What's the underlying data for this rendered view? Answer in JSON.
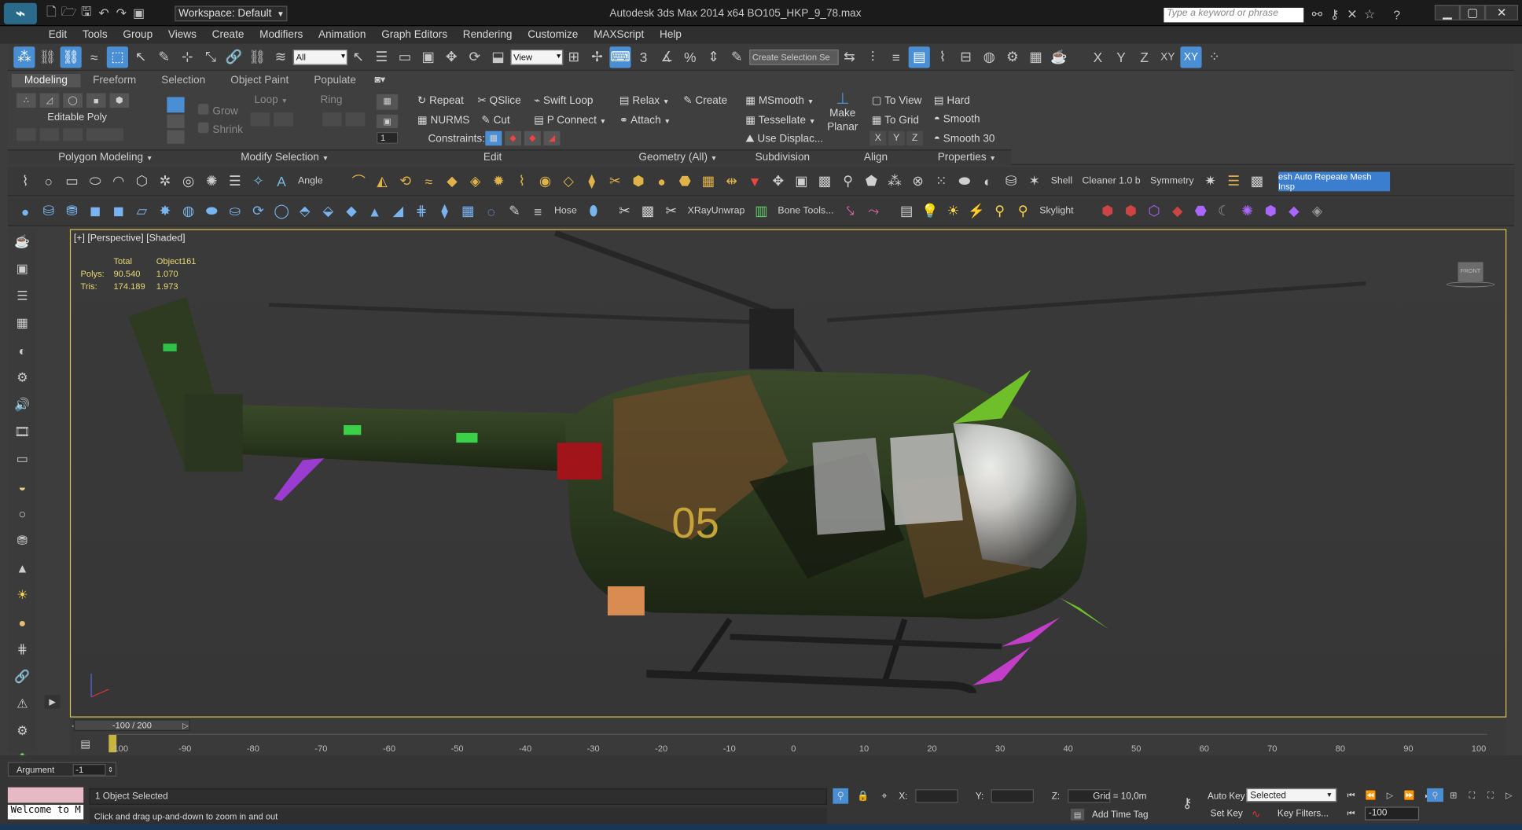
{
  "window": {
    "title": "Autodesk 3ds Max 2014 x64     BO105_HKP_9_78.max",
    "workspace": "Workspace: Default",
    "search_placeholder": "Type a keyword or phrase",
    "logo": "3ds Max"
  },
  "menu": [
    "Edit",
    "Tools",
    "Group",
    "Views",
    "Create",
    "Modifiers",
    "Animation",
    "Graph Editors",
    "Rendering",
    "Customize",
    "MAXScript",
    "Help"
  ],
  "main_toolbar": {
    "selection_filter": "All",
    "ref_coord": "View",
    "named_selection_placeholder": "Create Selection Se",
    "axis_buttons": [
      "X",
      "Y",
      "Z",
      "XY",
      "XY"
    ]
  },
  "ribbon": {
    "tabs": [
      "Modeling",
      "Freeform",
      "Selection",
      "Object Paint",
      "Populate"
    ],
    "active_tab": "Modeling",
    "editable_poly": "Editable Poly",
    "grow": "Grow",
    "shrink": "Shrink",
    "loop": "Loop",
    "ring": "Ring",
    "spinner_value": "1",
    "edit_buttons": [
      "Repeat",
      "QSlice",
      "Swift Loop",
      "NURMS",
      "Cut",
      "P Connect"
    ],
    "constraints": "Constraints:",
    "geometry_buttons": [
      "Relax",
      "Create",
      "Attach"
    ],
    "subdivision_buttons": [
      "MSmooth",
      "Tessellate",
      "Use Displac..."
    ],
    "make_planar": "Make\nPlanar",
    "align_buttons": [
      "To View",
      "To Grid"
    ],
    "xyz": [
      "X",
      "Y",
      "Z"
    ],
    "properties_buttons": [
      "Hard",
      "Smooth",
      "Smooth 30"
    ],
    "group_labels": {
      "polygon_modeling": "Polygon Modeling",
      "modify_selection": "Modify Selection",
      "edit": "Edit",
      "geometry": "Geometry (All)",
      "subdivision": "Subdivision",
      "align": "Align",
      "properties": "Properties"
    }
  },
  "toolrow1": {
    "angle": "Angle",
    "shell": "Shell",
    "cleaner": "Cleaner 1.0 b",
    "symmetry": "Symmetry",
    "highlight": "esh Auto Repeate Mesh Insp"
  },
  "toolrow2": {
    "hose": "Hose",
    "xray": "XRayUnwrap",
    "bone_tools": "Bone Tools...",
    "skylight": "Skylight"
  },
  "viewport": {
    "label": "[+] [Perspective] [Shaded]",
    "stats": {
      "col_total": "Total",
      "col_object": "Object161",
      "polys_label": "Polys:",
      "polys_total": "90.540",
      "polys_object": "1.070",
      "tris_label": "Tris:",
      "tris_total": "174.189",
      "tris_object": "1.973"
    },
    "heli_number": "05",
    "viewcube_label": "FRONT"
  },
  "timeline": {
    "slider": "-100 / 200",
    "ticks": [
      "-100",
      "-90",
      "-80",
      "-70",
      "-60",
      "-50",
      "-40",
      "-30",
      "-20",
      "-10",
      "0",
      "10",
      "20",
      "30",
      "40",
      "50",
      "60",
      "70",
      "80",
      "90",
      "100"
    ]
  },
  "status": {
    "argument_label": "Argument",
    "argument_value": "-1",
    "welcome": "Welcome to M",
    "selected": "1 Object Selected",
    "prompt": "Click and drag up-and-down to zoom in and out",
    "x_label": "X:",
    "y_label": "Y:",
    "z_label": "Z:",
    "grid": "Grid = 10,0m",
    "add_time_tag": "Add Time Tag",
    "auto_key": "Auto Key",
    "set_key": "Set Key",
    "selection_set": "Selected",
    "key_filters": "Key Filters...",
    "frame": "-100"
  },
  "colors": {
    "accent": "#4a8fd4",
    "viewport_border": "#d8c14a",
    "stats_text": "#e8d874"
  }
}
